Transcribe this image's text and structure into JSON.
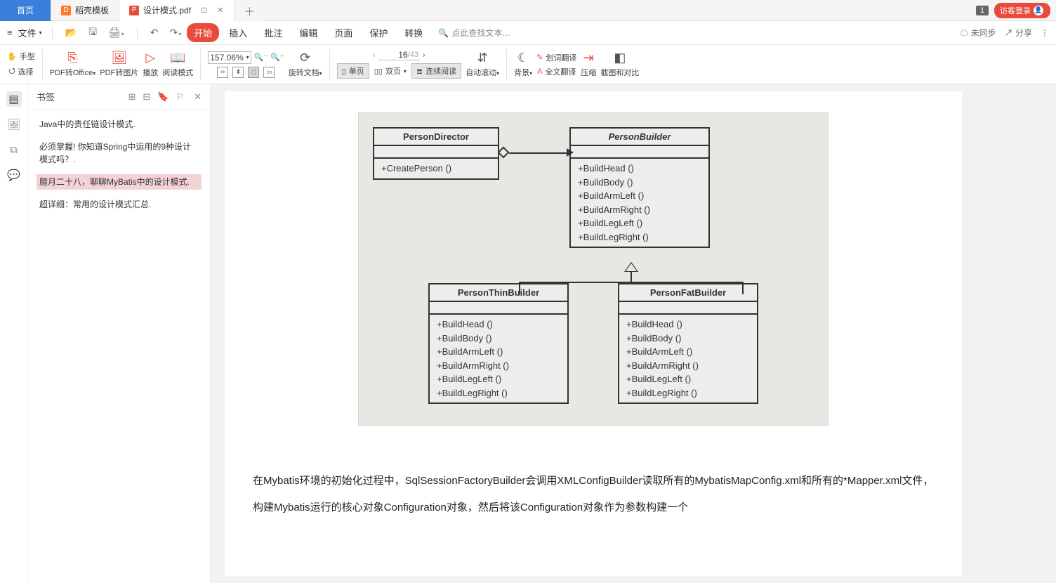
{
  "titlebar": {
    "home": "首页",
    "shell": "稻壳模板",
    "doc": "设计模式.pdf",
    "badge": "1",
    "login": "访客登录"
  },
  "menubar": {
    "file": "文件",
    "tabs": {
      "start": "开始",
      "insert": "插入",
      "annotate": "批注",
      "edit": "编辑",
      "page": "页面",
      "protect": "保护",
      "convert": "转换"
    },
    "search_placeholder": "点此查找文本…",
    "unsynced": "未同步",
    "share": "分享"
  },
  "ribbon": {
    "hand": "手型",
    "select": "选择",
    "pdf_office": "PDF转Office",
    "pdf_img": "PDF转图片",
    "play": "播放",
    "read": "阅读模式",
    "zoom": "157.06%",
    "rotate": "旋转文档",
    "single": "单页",
    "double": "双页",
    "continuous": "连续阅读",
    "autoscroll": "自动滚动",
    "bg": "背景",
    "word_trans": "划词翻译",
    "full_trans": "全文翻译",
    "compress": "压缩",
    "compare": "截图和对比",
    "page_current": "16",
    "page_total": "/43"
  },
  "bookmarks": {
    "title": "书签",
    "items": [
      "Java中的责任链设计模式.",
      "必须掌握! 你知道Spring中运用的9种设计模式吗？.",
      "腊月二十八，聊聊MyBatis中的设计模式.",
      "超详细：常用的设计模式汇总."
    ],
    "selected": 2
  },
  "uml": {
    "director": {
      "name": "PersonDirector",
      "methods": [
        "+CreatePerson ()"
      ]
    },
    "builder": {
      "name": "PersonBuilder",
      "methods": [
        "+BuildHead ()",
        "+BuildBody ()",
        "+BuildArmLeft ()",
        "+BuildArmRight ()",
        "+BuildLegLeft ()",
        "+BuildLegRight ()"
      ]
    },
    "thin": {
      "name": "PersonThinBuilder",
      "methods": [
        "+BuildHead ()",
        "+BuildBody ()",
        "+BuildArmLeft ()",
        "+BuildArmRight ()",
        "+BuildLegLeft ()",
        "+BuildLegRight ()"
      ]
    },
    "fat": {
      "name": "PersonFatBuilder",
      "methods": [
        "+BuildHead ()",
        "+BuildBody ()",
        "+BuildArmLeft ()",
        "+BuildArmRight ()",
        "+BuildLegLeft ()",
        "+BuildLegRight ()"
      ]
    }
  },
  "doc_text": "在Mybatis环境的初始化过程中，SqlSessionFactoryBuilder会调用XMLConfigBuilder读取所有的MybatisMapConfig.xml和所有的*Mapper.xml文件，构建Mybatis运行的核心对象Configuration对象，然后将该Configuration对象作为参数构建一个"
}
